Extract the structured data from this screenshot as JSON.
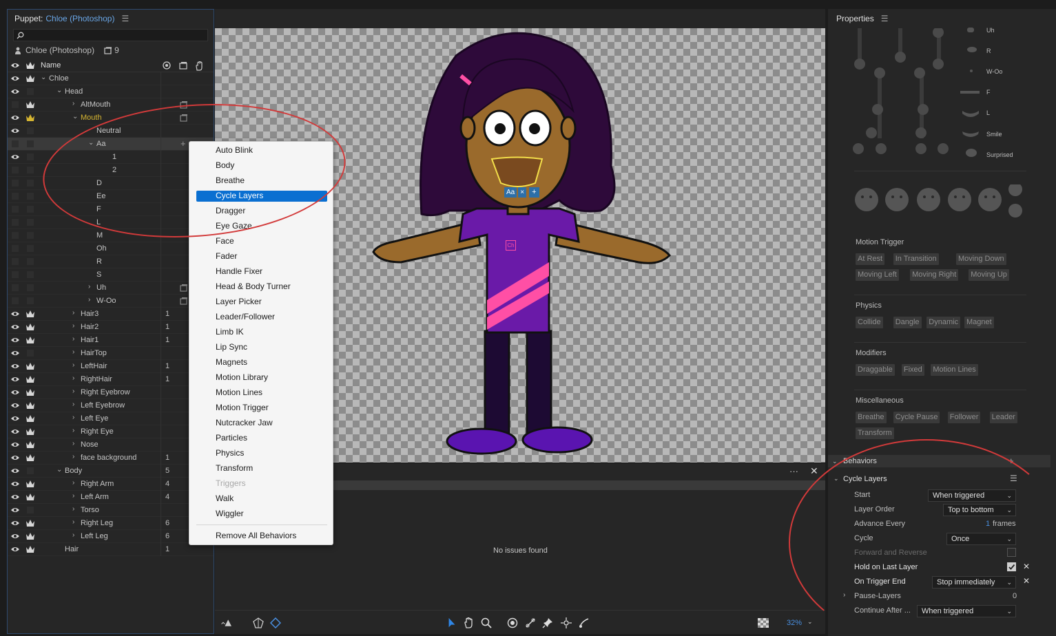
{
  "left_panel": {
    "title_prefix": "Puppet:",
    "title_name": "Chloe (Photoshop)",
    "puppet_name": "Chloe (Photoshop)",
    "puppet_count": "9",
    "column_name": "Name",
    "layers": [
      {
        "name": "Chloe",
        "indent": 0,
        "chev": "v",
        "vis": true,
        "crown": true,
        "num": "",
        "ricon": false
      },
      {
        "name": "Head",
        "indent": 1,
        "chev": "v",
        "vis": true,
        "crown": false,
        "num": "",
        "ricon": false
      },
      {
        "name": "AltMouth",
        "indent": 2,
        "chev": ">",
        "vis": false,
        "crown": true,
        "num": "",
        "ricon": true
      },
      {
        "name": "Mouth",
        "indent": 2,
        "chev": "v",
        "vis": true,
        "crown": true,
        "yellow": true,
        "num": "",
        "ricon": true
      },
      {
        "name": "Neutral",
        "indent": 3,
        "chev": "",
        "vis": true,
        "crown": false,
        "num": "",
        "ricon": false
      },
      {
        "name": "Aa",
        "indent": 3,
        "chev": "v",
        "vis": false,
        "crown": false,
        "selected": true,
        "num": "",
        "ricon": false
      },
      {
        "name": "1",
        "indent": 4,
        "chev": "",
        "vis": true,
        "crown": false,
        "num": "",
        "ricon": false
      },
      {
        "name": "2",
        "indent": 4,
        "chev": "",
        "vis": false,
        "crown": false,
        "num": "",
        "ricon": false
      },
      {
        "name": "D",
        "indent": 3,
        "chev": "",
        "vis": false,
        "crown": false,
        "num": "",
        "ricon": false
      },
      {
        "name": "Ee",
        "indent": 3,
        "chev": "",
        "vis": false,
        "crown": false,
        "num": "",
        "ricon": false
      },
      {
        "name": "F",
        "indent": 3,
        "chev": "",
        "vis": false,
        "crown": false,
        "num": "",
        "ricon": false
      },
      {
        "name": "L",
        "indent": 3,
        "chev": "",
        "vis": false,
        "crown": false,
        "num": "",
        "ricon": false
      },
      {
        "name": "M",
        "indent": 3,
        "chev": "",
        "vis": false,
        "crown": false,
        "num": "",
        "ricon": false
      },
      {
        "name": "Oh",
        "indent": 3,
        "chev": "",
        "vis": false,
        "crown": false,
        "num": "",
        "ricon": false
      },
      {
        "name": "R",
        "indent": 3,
        "chev": "",
        "vis": false,
        "crown": false,
        "num": "",
        "ricon": false
      },
      {
        "name": "S",
        "indent": 3,
        "chev": "",
        "vis": false,
        "crown": false,
        "num": "",
        "ricon": false
      },
      {
        "name": "Uh",
        "indent": 3,
        "chev": ">",
        "vis": false,
        "crown": false,
        "num": "",
        "ricon": true
      },
      {
        "name": "W-Oo",
        "indent": 3,
        "chev": ">",
        "vis": false,
        "crown": false,
        "num": "",
        "ricon": true
      },
      {
        "name": "Hair3",
        "indent": 2,
        "chev": ">",
        "vis": true,
        "crown": true,
        "num": "1",
        "ricon": false
      },
      {
        "name": "Hair2",
        "indent": 2,
        "chev": ">",
        "vis": true,
        "crown": true,
        "num": "1",
        "ricon": false
      },
      {
        "name": "Hair1",
        "indent": 2,
        "chev": ">",
        "vis": true,
        "crown": true,
        "num": "1",
        "ricon": false
      },
      {
        "name": "HairTop",
        "indent": 2,
        "chev": ">",
        "vis": true,
        "crown": false,
        "num": "",
        "ricon": false
      },
      {
        "name": "LeftHair",
        "indent": 2,
        "chev": ">",
        "vis": true,
        "crown": true,
        "num": "1",
        "ricon": false
      },
      {
        "name": "RightHair",
        "indent": 2,
        "chev": ">",
        "vis": true,
        "crown": true,
        "num": "1",
        "ricon": false
      },
      {
        "name": "Right Eyebrow",
        "indent": 2,
        "chev": ">",
        "vis": true,
        "crown": true,
        "num": "",
        "ricon": false
      },
      {
        "name": "Left Eyebrow",
        "indent": 2,
        "chev": ">",
        "vis": true,
        "crown": true,
        "num": "",
        "ricon": false
      },
      {
        "name": "Left Eye",
        "indent": 2,
        "chev": ">",
        "vis": true,
        "crown": true,
        "num": "",
        "ricon": false
      },
      {
        "name": "Right Eye",
        "indent": 2,
        "chev": ">",
        "vis": true,
        "crown": true,
        "num": "",
        "ricon": false
      },
      {
        "name": "Nose",
        "indent": 2,
        "chev": ">",
        "vis": true,
        "crown": true,
        "num": "",
        "ricon": false
      },
      {
        "name": "face background",
        "indent": 2,
        "chev": ">",
        "vis": true,
        "crown": true,
        "num": "1",
        "ricon": false
      },
      {
        "name": "Body",
        "indent": 1,
        "chev": "v",
        "vis": true,
        "crown": false,
        "num": "5",
        "ricon": false
      },
      {
        "name": "Right Arm",
        "indent": 2,
        "chev": ">",
        "vis": true,
        "crown": true,
        "num": "4",
        "ricon": false
      },
      {
        "name": "Left Arm",
        "indent": 2,
        "chev": ">",
        "vis": true,
        "crown": true,
        "num": "4",
        "ricon": false
      },
      {
        "name": "Torso",
        "indent": 2,
        "chev": ">",
        "vis": true,
        "crown": false,
        "num": "",
        "ricon": false
      },
      {
        "name": "Right Leg",
        "indent": 2,
        "chev": ">",
        "vis": true,
        "crown": true,
        "num": "6",
        "ricon": false
      },
      {
        "name": "Left Leg",
        "indent": 2,
        "chev": ">",
        "vis": true,
        "crown": true,
        "num": "6",
        "ricon": false
      },
      {
        "name": "Hair",
        "indent": 1,
        "chev": "",
        "vis": true,
        "crown": true,
        "num": "1",
        "ricon": false
      }
    ]
  },
  "context_menu": {
    "items": [
      "Auto Blink",
      "Body",
      "Breathe",
      "Cycle Layers",
      "Dragger",
      "Eye Gaze",
      "Face",
      "Fader",
      "Handle Fixer",
      "Head & Body Turner",
      "Layer Picker",
      "Leader/Follower",
      "Limb IK",
      "Lip Sync",
      "Magnets",
      "Motion Library",
      "Motion Lines",
      "Motion Trigger",
      "Nutcracker Jaw",
      "Particles",
      "Physics",
      "Transform",
      "Triggers",
      "Walk",
      "Wiggler"
    ],
    "active": "Cycle Layers",
    "disabled": "Triggers",
    "remove_all": "Remove All Behaviors"
  },
  "stage": {
    "handle_label": "Aa",
    "handle_close": "×",
    "handle_add": "+",
    "ch_badge": "Ch"
  },
  "bottom": {
    "message": "No issues found",
    "dots": "···",
    "close": "✕",
    "zoom": "32%"
  },
  "properties": {
    "title": "Properties",
    "visemes": [
      "Uh",
      "R",
      "W-Oo",
      "F",
      "L",
      "Smile",
      "Surprised"
    ],
    "motion_trigger": {
      "title": "Motion Trigger",
      "tags": [
        "At Rest",
        "In Transition",
        "Moving Down",
        "Moving Left",
        "Moving Right",
        "Moving Up"
      ]
    },
    "physics": {
      "title": "Physics",
      "tags": [
        "Collide",
        "Dangle",
        "Dynamic",
        "Magnet"
      ]
    },
    "modifiers": {
      "title": "Modifiers",
      "tags": [
        "Draggable",
        "Fixed",
        "Motion Lines"
      ]
    },
    "misc": {
      "title": "Miscellaneous",
      "tags": [
        "Breathe",
        "Cycle Pause",
        "Follower",
        "Leader",
        "Transform"
      ]
    },
    "behaviors_title": "Behaviors",
    "behaviors_add": "+",
    "cycle_layers": {
      "title": "Cycle Layers",
      "start_label": "Start",
      "start_value": "When triggered",
      "order_label": "Layer Order",
      "order_value": "Top to bottom",
      "advance_label": "Advance Every",
      "advance_value": "1",
      "advance_unit": "frames",
      "cycle_label": "Cycle",
      "cycle_value": "Once",
      "fwd_label": "Forward and Reverse",
      "hold_label": "Hold on Last Layer",
      "trigger_end_label": "On Trigger End",
      "trigger_end_value": "Stop immediately",
      "pause_label": "Pause-Layers",
      "pause_value": "0",
      "continue_label": "Continue After ...",
      "continue_value": "When triggered"
    }
  },
  "colors": {
    "accent": "#0a6fd1",
    "annotation": "#d23a3a",
    "puppet_skin": "#9a6a2c",
    "puppet_hair": "#2e0a3a",
    "puppet_shirt": "#6a1aa8"
  }
}
